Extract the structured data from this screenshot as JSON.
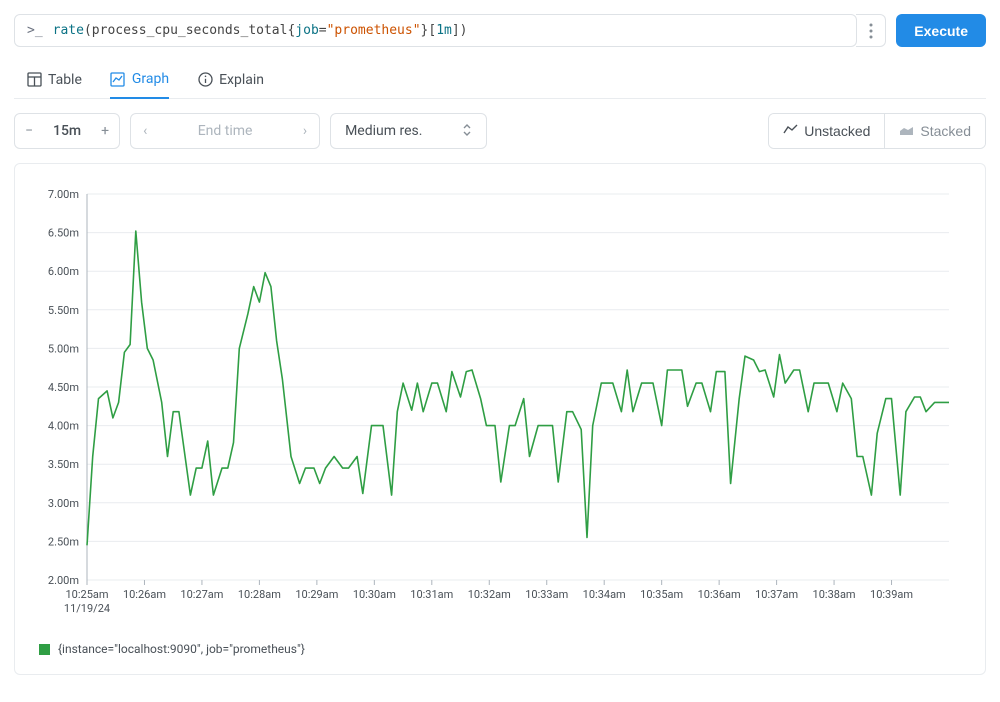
{
  "query": {
    "fn": "rate",
    "metric": "process_cpu_seconds_total",
    "label_key": "job",
    "label_val": "\"prometheus\"",
    "range": "1m"
  },
  "execute_label": "Execute",
  "tabs": {
    "table": "Table",
    "graph": "Graph",
    "explain": "Explain"
  },
  "controls": {
    "range": "15m",
    "endtime_placeholder": "End time",
    "resolution": "Medium res.",
    "unstacked": "Unstacked",
    "stacked": "Stacked"
  },
  "legend_text": "{instance=\"localhost:9090\", job=\"prometheus\"}",
  "chart_data": {
    "type": "line",
    "title": "",
    "xlabel": "",
    "ylabel": "",
    "x_date": "11/19/24",
    "x_ticks": [
      "10:25am",
      "10:26am",
      "10:27am",
      "10:28am",
      "10:29am",
      "10:30am",
      "10:31am",
      "10:32am",
      "10:33am",
      "10:34am",
      "10:35am",
      "10:36am",
      "10:37am",
      "10:38am",
      "10:39am"
    ],
    "y_ticks": [
      "2.00m",
      "2.50m",
      "3.00m",
      "3.50m",
      "4.00m",
      "4.50m",
      "5.00m",
      "5.50m",
      "6.00m",
      "6.50m",
      "7.00m"
    ],
    "ylim": [
      2.0,
      7.0
    ],
    "xlim": [
      0,
      15
    ],
    "series": [
      {
        "name": "{instance=\"localhost:9090\", job=\"prometheus\"}",
        "color": "#2f9e44",
        "x": [
          0.0,
          0.1,
          0.2,
          0.35,
          0.45,
          0.55,
          0.65,
          0.75,
          0.85,
          0.95,
          1.05,
          1.15,
          1.3,
          1.4,
          1.5,
          1.6,
          1.8,
          1.9,
          2.0,
          2.1,
          2.2,
          2.35,
          2.45,
          2.55,
          2.65,
          2.8,
          2.9,
          3.0,
          3.1,
          3.2,
          3.3,
          3.4,
          3.55,
          3.7,
          3.8,
          3.95,
          4.05,
          4.15,
          4.3,
          4.45,
          4.55,
          4.7,
          4.8,
          4.95,
          5.05,
          5.15,
          5.3,
          5.4,
          5.5,
          5.65,
          5.75,
          5.85,
          6.0,
          6.1,
          6.25,
          6.35,
          6.5,
          6.6,
          6.7,
          6.85,
          6.95,
          7.1,
          7.2,
          7.35,
          7.45,
          7.6,
          7.7,
          7.85,
          7.95,
          8.1,
          8.2,
          8.35,
          8.45,
          8.6,
          8.7,
          8.8,
          8.95,
          9.05,
          9.15,
          9.3,
          9.4,
          9.5,
          9.65,
          9.75,
          9.85,
          10.0,
          10.1,
          10.2,
          10.35,
          10.45,
          10.6,
          10.7,
          10.85,
          10.95,
          11.1,
          11.2,
          11.35,
          11.45,
          11.6,
          11.7,
          11.8,
          11.95,
          12.05,
          12.15,
          12.3,
          12.4,
          12.55,
          12.65,
          12.8,
          12.9,
          13.05,
          13.15,
          13.3,
          13.4,
          13.5,
          13.65,
          13.75,
          13.9,
          14.0,
          14.15,
          14.25,
          14.4,
          14.5,
          14.6,
          14.75,
          14.85,
          15.0
        ],
        "values": [
          2.45,
          3.6,
          4.35,
          4.45,
          4.1,
          4.3,
          4.95,
          5.05,
          6.52,
          5.6,
          5.0,
          4.85,
          4.3,
          3.6,
          4.18,
          4.18,
          3.1,
          3.45,
          3.45,
          3.8,
          3.1,
          3.45,
          3.45,
          3.78,
          5.0,
          5.45,
          5.8,
          5.6,
          5.98,
          5.8,
          5.1,
          4.6,
          3.6,
          3.25,
          3.45,
          3.45,
          3.25,
          3.45,
          3.6,
          3.45,
          3.45,
          3.6,
          3.12,
          4.0,
          4.0,
          4.0,
          3.1,
          4.18,
          4.55,
          4.2,
          4.55,
          4.18,
          4.55,
          4.55,
          4.18,
          4.7,
          4.37,
          4.7,
          4.72,
          4.35,
          4.0,
          4.0,
          3.27,
          4.0,
          4.0,
          4.35,
          3.6,
          4.0,
          4.0,
          4.0,
          3.27,
          4.18,
          4.18,
          3.95,
          2.55,
          4.0,
          4.55,
          4.55,
          4.55,
          4.18,
          4.72,
          4.18,
          4.55,
          4.55,
          4.55,
          4.0,
          4.72,
          4.72,
          4.72,
          4.25,
          4.55,
          4.55,
          4.18,
          4.7,
          4.7,
          3.25,
          4.35,
          4.9,
          4.85,
          4.7,
          4.72,
          4.37,
          4.92,
          4.55,
          4.72,
          4.72,
          4.18,
          4.55,
          4.55,
          4.55,
          4.18,
          4.55,
          4.35,
          3.6,
          3.6,
          3.1,
          3.9,
          4.35,
          4.35,
          3.1,
          4.18,
          4.37,
          4.37,
          4.18,
          4.3,
          4.3,
          4.3
        ]
      }
    ]
  }
}
